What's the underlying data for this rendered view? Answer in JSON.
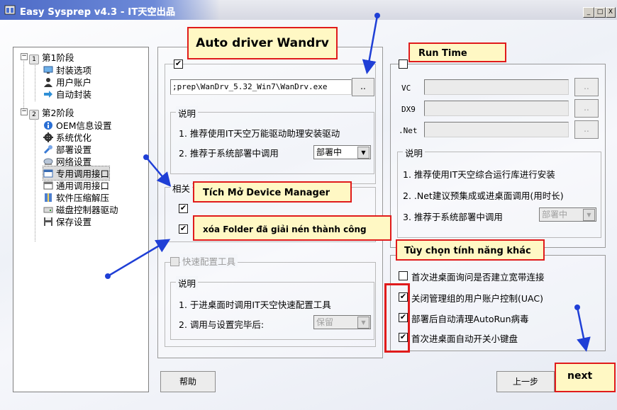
{
  "window": {
    "title": "Easy Sysprep v4.3 - IT天空出品",
    "controls": [
      "_",
      "□",
      "X"
    ]
  },
  "tree": {
    "stage1": {
      "num": "1",
      "label": "第1阶段",
      "toggle": "−"
    },
    "stage1_items": [
      "封装选项",
      "用户账户",
      "自动封装"
    ],
    "stage2": {
      "num": "2",
      "label": "第2阶段",
      "toggle": "−"
    },
    "stage2_items": [
      "OEM信息设置",
      "系统优化",
      "部署设置",
      "网络设置",
      "专用调用接口",
      "通用调用接口",
      "软件压缩解压",
      "磁盘控制器驱动",
      "保存设置"
    ]
  },
  "driver": {
    "path": ";prep\\WanDrv_5.32_Win7\\WanDrv.exe",
    "browse": "..",
    "group_label": "说明",
    "line1": "1. 推荐使用IT天空万能驱动助理安装驱动",
    "line2": "2. 推荐于系统部署中调用",
    "combo": "部署中"
  },
  "related": {
    "group_label": "相关",
    "cb1": "✔",
    "cb2": "✔"
  },
  "quick": {
    "label": "快速配置工具",
    "group_label": "说明",
    "line1": "1. 于进桌面时调用IT天空快速配置工具",
    "line2": "2. 调用与设置完毕后:",
    "combo": "保留"
  },
  "runtime": {
    "rows": [
      {
        "label": "VC",
        "browse": ".."
      },
      {
        "label": "DX9",
        "browse": ".."
      },
      {
        "label": ".Net",
        "browse": ".."
      }
    ],
    "group_label": "说明",
    "line1": "1. 推荐使用IT天空综合运行库进行安装",
    "line2": "2. .Net建议预集成或进桌面调用(用时长)",
    "line3": "3. 推荐于系统部署中调用",
    "combo": "部署中"
  },
  "other": {
    "items": [
      {
        "label": "首次进桌面询问是否建立宽带连接",
        "check": ""
      },
      {
        "label": "关闭管理组的用户账户控制(UAC)",
        "check": "✔"
      },
      {
        "label": "部署后自动清理AutoRun病毒",
        "check": "✔"
      },
      {
        "label": "首次进桌面自动开关小键盘",
        "check": "✔"
      }
    ]
  },
  "buttons": {
    "help": "帮助",
    "prev": "上一步"
  },
  "annotations": {
    "auto_driver": "Auto driver Wandrv",
    "run_time": "Run Time",
    "device_manager": "Tích Mở Device Manager",
    "xoa_folder": "xóa Folder đã giải nén thành công",
    "tuy_chon": "Tùy chọn tính năng khác",
    "next": "next"
  },
  "colors": {
    "annotation_border": "#e01b1b",
    "annotation_fill": "#fff8c4",
    "arrow": "#1f3fd6"
  }
}
